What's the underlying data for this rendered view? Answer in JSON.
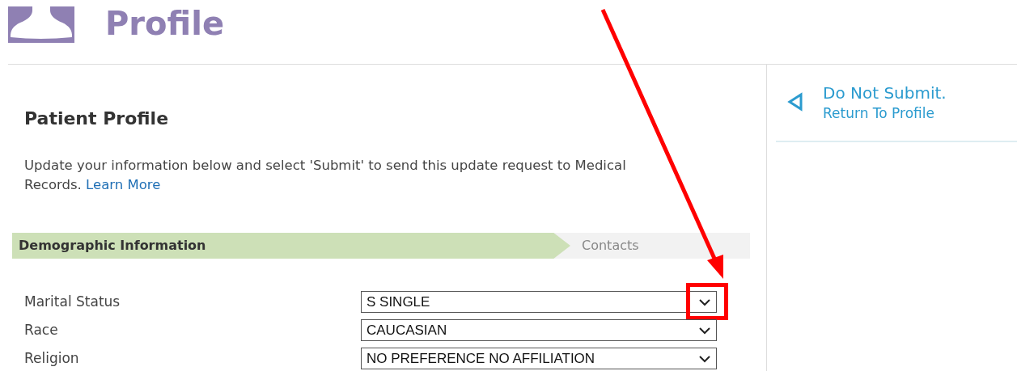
{
  "header": {
    "title": "Profile"
  },
  "main": {
    "heading": "Patient Profile",
    "intro": "Update your information below and select 'Submit' to send this update request to Medical Records.",
    "learn_more": "Learn More"
  },
  "steps": [
    {
      "label": "Demographic Information",
      "selected": true
    },
    {
      "label": "Contacts",
      "selected": false
    }
  ],
  "fields": [
    {
      "label": "Marital Status",
      "value": "S SINGLE",
      "highlighted": true
    },
    {
      "label": "Race",
      "value": "CAUCASIAN",
      "highlighted": false
    },
    {
      "label": "Religion",
      "value": "NO PREFERENCE NO AFFILIATION",
      "highlighted": false
    }
  ],
  "side": {
    "title": "Do Not Submit.",
    "link": "Return To Profile"
  }
}
